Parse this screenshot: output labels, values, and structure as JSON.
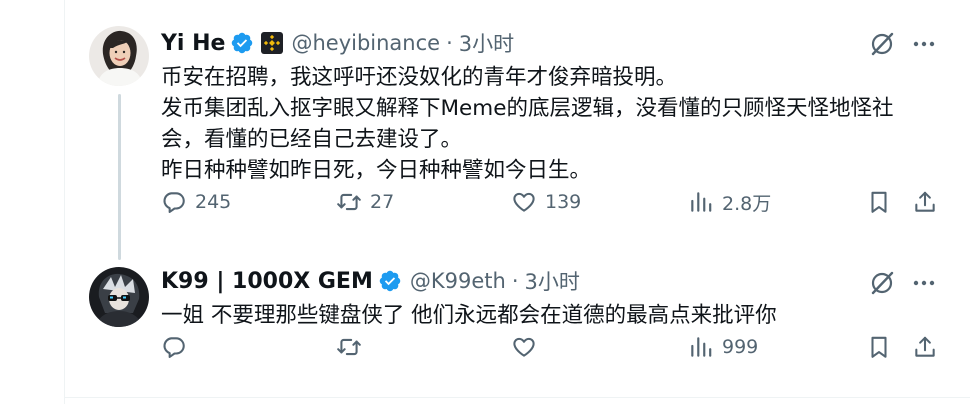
{
  "tweets": [
    {
      "author": {
        "name": "Yi He",
        "handle": "@heyibinance",
        "time": "3小时",
        "verified": true,
        "affiliation_badge": "binance-logo"
      },
      "text_lines": [
        "币安在招聘，我这呼吁还没奴化的青年才俊弃暗投明。",
        "发币集团乱入抠字眼又解释下Meme的底层逻辑，没看懂的只顾怪天怪地怪社",
        "会，看懂的已经自己去建设了。",
        "昨日种种譬如昨日死，今日种种譬如今日生。"
      ],
      "metrics": {
        "replies": "245",
        "retweets": "27",
        "likes": "139",
        "views": "2.8万"
      }
    },
    {
      "author": {
        "name": "K99 | 1000X GEM",
        "handle": "@K99eth",
        "time": "3小时",
        "verified": true
      },
      "text_lines": [
        "一姐 不要理那些键盘侠了 他们永远都会在道德的最高点来批评你"
      ],
      "metrics": {
        "replies": "",
        "retweets": "",
        "likes": "",
        "views": "999"
      }
    }
  ],
  "colors": {
    "text": "#0f1419",
    "secondary": "#536471",
    "verified_blue": "#1d9bf0",
    "binance_yellow": "#f0b90b",
    "divider": "#eff3f4"
  },
  "separator": "·"
}
